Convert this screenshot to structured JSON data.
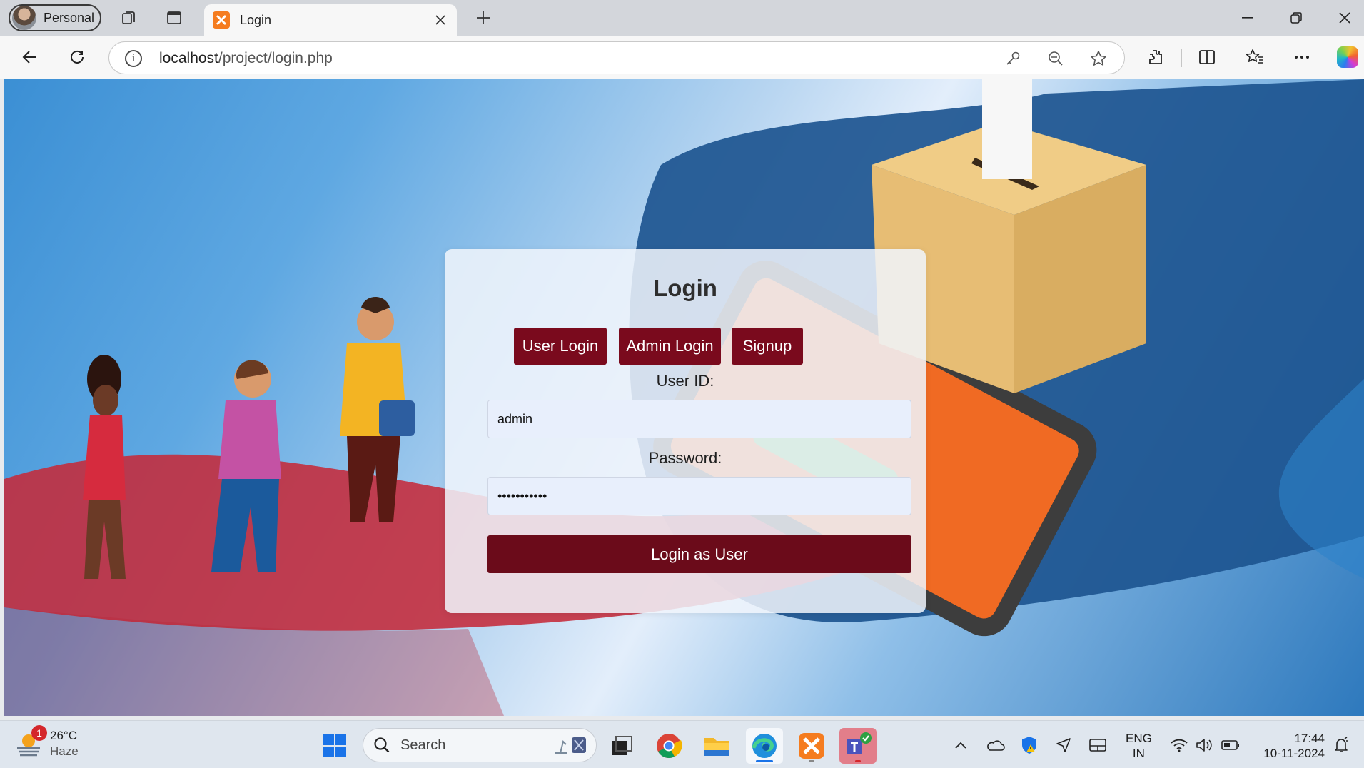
{
  "browser": {
    "profile_label": "Personal",
    "tab_title": "Login",
    "url_host": "localhost",
    "url_path": "/project/login.php"
  },
  "login": {
    "title": "Login",
    "tabs": [
      "User Login",
      "Admin Login",
      "Signup"
    ],
    "user_id_label": "User ID:",
    "user_id_value": "admin",
    "password_label": "Password:",
    "password_value": "•••••••••••",
    "submit_label": "Login as User"
  },
  "taskbar": {
    "weather_badge": "1",
    "temperature": "26°C",
    "condition": "Haze",
    "search_placeholder": "Search",
    "lang_line1": "ENG",
    "lang_line2": "IN",
    "time": "17:44",
    "date": "10-11-2024"
  },
  "colors": {
    "accent_maroon": "#7a0a1d",
    "submit_maroon": "#6b0b1a",
    "field_bg": "#e8effc"
  }
}
